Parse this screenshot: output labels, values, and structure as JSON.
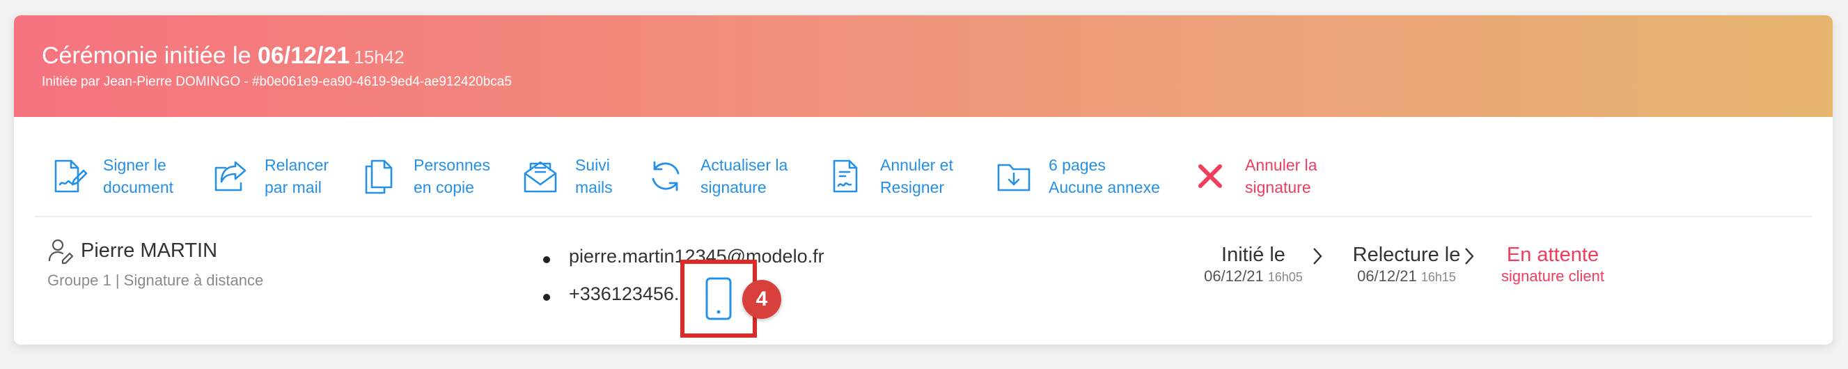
{
  "header": {
    "title_prefix": "Cérémonie initiée le ",
    "date": "06/12/21",
    "time": "15h42",
    "subtitle": "Initiée par Jean-Pierre DOMINGO - #b0e061e9-ea90-4619-9ed4-ae912420bca5",
    "gradient": [
      "#f6737f",
      "#e7b570"
    ]
  },
  "actions": [
    {
      "label": "Signer le\ndocument",
      "icon": "sign-document-icon"
    },
    {
      "label": "Relancer\npar mail",
      "icon": "share-forward-icon"
    },
    {
      "label": "Personnes\nen copie",
      "icon": "copy-icon"
    },
    {
      "label": "Suivi\nmails",
      "icon": "mail-tracking-icon"
    },
    {
      "label": "Actualiser la\nsignature",
      "icon": "refresh-icon"
    },
    {
      "label": "Annuler et\nResigner",
      "icon": "document-signature-icon"
    },
    {
      "label": "6 pages\nAucune annexe",
      "icon": "folder-download-icon"
    },
    {
      "label": "Annuler la\nsignature",
      "icon": "close-icon"
    }
  ],
  "signer": {
    "name": "Pierre MARTIN",
    "group": "Groupe 1 | Signature à distance",
    "email": "pierre.martin12345@modelo.fr",
    "phone": "+336123456."
  },
  "annotation": {
    "step": "4"
  },
  "timeline": [
    {
      "title": "Initié le",
      "date": "06/12/21",
      "time": "16h05"
    },
    {
      "title": "Relecture le",
      "date": "06/12/21",
      "time": "16h15"
    },
    {
      "title": "En attente",
      "detail": "signature client"
    }
  ],
  "colors": {
    "accent": "#2590e6",
    "danger": "#ef3e5c",
    "annotation": "#e02826"
  }
}
